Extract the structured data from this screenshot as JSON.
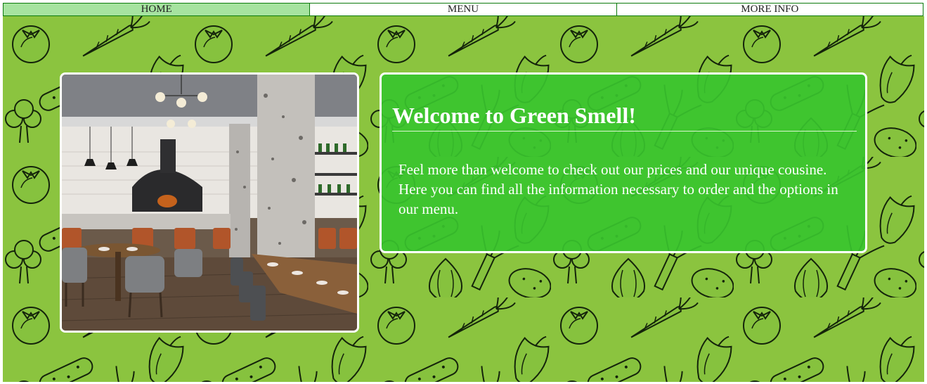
{
  "nav": {
    "items": [
      {
        "label": "HOME",
        "active": true
      },
      {
        "label": "MENU",
        "active": false
      },
      {
        "label": "MORE INFO",
        "active": false
      }
    ]
  },
  "hero": {
    "background_color": "#8bc43f",
    "background_pattern": "vegetable-doodle-pattern",
    "image": "restaurant-interior-photo",
    "welcome": {
      "title": "Welcome to Green Smell!",
      "text": "Feel more than welcome to check out our prices and our unique cousine. Here you can find all the information necessary to order and the options in our menu."
    }
  },
  "colors": {
    "nav_active": "#a6e3a0",
    "nav_border": "#0c7a0c",
    "card_green": "#38c42e"
  }
}
